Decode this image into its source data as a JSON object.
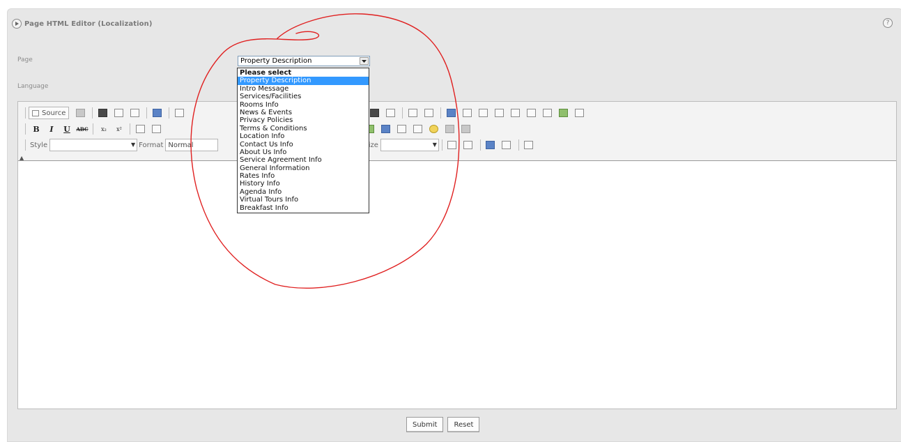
{
  "panel": {
    "title": "Page HTML Editor (Localization)",
    "help_symbol": "?"
  },
  "form": {
    "page_label": "Page",
    "language_label": "Language",
    "page_select": {
      "value": "Property Description",
      "options": [
        "Please select",
        "Property Description",
        "Intro Message",
        "Services/Facilities",
        "Rooms Info",
        "News & Events",
        "Privacy Policies",
        "Terms & Conditions",
        "Location Info",
        "Contact Us Info",
        "About Us Info",
        "Service Agreement Info",
        "General Information",
        "Rates Info",
        "History Info",
        "Agenda Info",
        "Virtual Tours Info",
        "Breakfast Info"
      ],
      "highlighted_option": "Property Description"
    }
  },
  "editor": {
    "source_label": "Source",
    "style_label": "Style",
    "format_label": "Format",
    "format_value": "Normal",
    "size_label": "Size",
    "bold": "B",
    "italic": "I",
    "underline": "U",
    "strike": "ABC",
    "subscript": "x₂",
    "superscript": "x²"
  },
  "buttons": {
    "submit": "Submit",
    "reset": "Reset"
  },
  "colors": {
    "panel_bg": "#e7e7e7",
    "selection": "#3399ff",
    "annotation_stroke": "#e02020"
  }
}
